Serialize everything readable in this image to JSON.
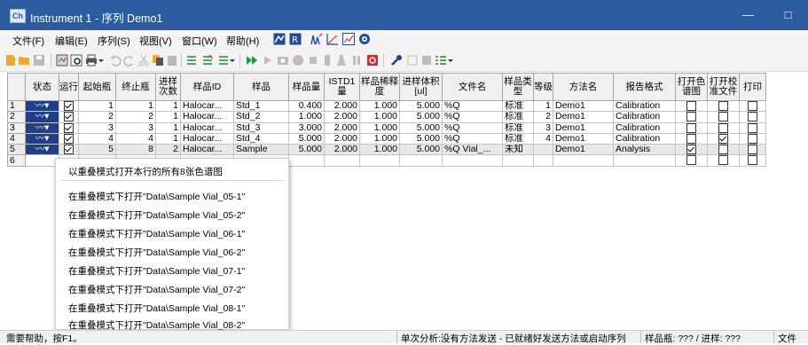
{
  "window": {
    "title": "Instrument 1 - 序列 Demo1",
    "icon": "app-icon",
    "minimize": "—",
    "maximize": "□",
    "close": "✕"
  },
  "menu": [
    "文件(F)",
    "编辑(E)",
    "序列(S)",
    "视图(V)",
    "窗口(W)",
    "帮助(H)"
  ],
  "columns": [
    "状态",
    "运行",
    "起始瓶",
    "终止瓶",
    "进样次数",
    "样品ID",
    "样品",
    "样品量",
    "ISTD1量",
    "样品稀释度",
    "进样体积[ul]",
    "文件名",
    "样品类型",
    "等级",
    "方法名",
    "报告格式",
    "打开色谱图",
    "打开校准文件",
    "打印"
  ],
  "rows": [
    {
      "num": "1",
      "status": "status-icon",
      "run": true,
      "start": "1",
      "end": "1",
      "inj": "1",
      "sample_id": "Halocar...",
      "sample": "Std_1",
      "amount": "0.400",
      "istd": "2.000",
      "dilution": "1.000",
      "volume": "5.000",
      "file": "%Q",
      "type": "标准",
      "level": "1",
      "method": "Demo1",
      "report": "Calibration",
      "open_chrom": false,
      "open_cal": false,
      "print": false
    },
    {
      "num": "2",
      "status": "status-icon",
      "run": true,
      "start": "2",
      "end": "2",
      "inj": "1",
      "sample_id": "Halocar...",
      "sample": "Std_2",
      "amount": "1.000",
      "istd": "2.000",
      "dilution": "1.000",
      "volume": "5.000",
      "file": "%Q",
      "type": "标准",
      "level": "2",
      "method": "Demo1",
      "report": "Calibration",
      "open_chrom": false,
      "open_cal": false,
      "print": false
    },
    {
      "num": "3",
      "status": "status-icon",
      "run": true,
      "start": "3",
      "end": "3",
      "inj": "1",
      "sample_id": "Halocar...",
      "sample": "Std_3",
      "amount": "3.000",
      "istd": "2.000",
      "dilution": "1.000",
      "volume": "5.000",
      "file": "%Q",
      "type": "标准",
      "level": "3",
      "method": "Demo1",
      "report": "Calibration",
      "open_chrom": false,
      "open_cal": false,
      "print": false
    },
    {
      "num": "4",
      "status": "status-icon",
      "run": true,
      "start": "4",
      "end": "4",
      "inj": "1",
      "sample_id": "Halocar...",
      "sample": "Std_4",
      "amount": "5.000",
      "istd": "2.000",
      "dilution": "1.000",
      "volume": "5.000",
      "file": "%Q",
      "type": "标准",
      "level": "4",
      "method": "Demo1",
      "report": "Calibration",
      "open_chrom": false,
      "open_cal": true,
      "print": false
    },
    {
      "num": "5",
      "status": "status-icon",
      "run": true,
      "start": "5",
      "end": "8",
      "inj": "2",
      "sample_id": "Halocar...",
      "sample": "Sample",
      "amount": "5.000",
      "istd": "2.000",
      "dilution": "1.000",
      "volume": "5.000",
      "file": "%Q Vial_...",
      "type": "未知",
      "level": "",
      "method": "Demo1",
      "report": "Analysis",
      "open_chrom": true,
      "open_cal": false,
      "print": false
    },
    {
      "num": "6"
    }
  ],
  "context_menu": {
    "header": "以重叠模式打开本行的所有8张色谱图",
    "items": [
      "在重叠模式下打开\"Data\\Sample Vial_05-1\"",
      "在重叠模式下打开\"Data\\Sample Vial_05-2\"",
      "在重叠模式下打开\"Data\\Sample Vial_06-1\"",
      "在重叠模式下打开\"Data\\Sample Vial_06-2\"",
      "在重叠模式下打开\"Data\\Sample Vial_07-1\"",
      "在重叠模式下打开\"Data\\Sample Vial_07-2\"",
      "在重叠模式下打开\"Data\\Sample Vial_08-1\"",
      "在重叠模式下打开\"Data\\Sample Vial_08-2\""
    ]
  },
  "status": {
    "help": "需要帮助，按F1。",
    "analysis": "单次分析:没有方法发送 - 已就绪好发送方法或启动序列",
    "vial": "样品瓶: ??? / 进样: ???",
    "file": "文件"
  },
  "colors": {
    "titlebar": "#2b5ca0",
    "status_cell": "#1f3f8a"
  }
}
